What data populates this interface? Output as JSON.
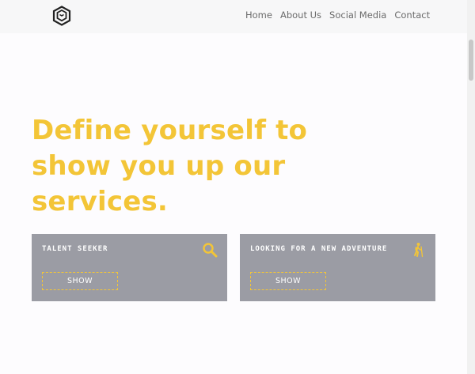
{
  "header": {
    "logo_icon": "hexagon-logo-icon",
    "nav": [
      {
        "label": "Home"
      },
      {
        "label": "About Us"
      },
      {
        "label": "Social Media"
      },
      {
        "label": "Contact"
      }
    ]
  },
  "hero": {
    "title": "Define yourself to show you up our services."
  },
  "cards": [
    {
      "title": "TALENT SEEKER",
      "icon": "search-icon",
      "button_label": "SHOW"
    },
    {
      "title": "LOOKING FOR A NEW ADVENTURE",
      "icon": "hiker-icon",
      "button_label": "SHOW"
    }
  ],
  "colors": {
    "accent": "#f3c537",
    "card_background": "#9b9ca4",
    "header_background": "#f7f7f8",
    "nav_text": "#6b6b6b"
  }
}
